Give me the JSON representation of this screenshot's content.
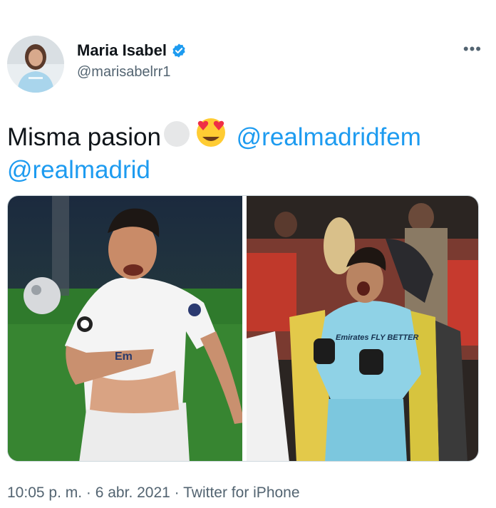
{
  "author": {
    "display_name": "Maria Isabel",
    "handle": "@marisabelrr1",
    "verified": true
  },
  "tweet": {
    "text_prefix": "Misma pasion",
    "mention_1": "@realmadridfem",
    "mention_2": "@realmadrid",
    "emojis": [
      "white-circle",
      "heart-eyes-face"
    ],
    "more_label": "•••"
  },
  "media": {
    "photos": [
      {
        "subject": "male-player-white-kit",
        "sponsor_text": "Em"
      },
      {
        "subject": "goalkeeper-light-blue-kit",
        "sponsor_text": "Emirates FLY BETTER"
      }
    ]
  },
  "meta": {
    "time": "10:05 p. m.",
    "separator": " · ",
    "date": "6 abr. 2021",
    "source": "Twitter for iPhone"
  },
  "colors": {
    "link": "#1d9bf0",
    "secondary_text": "#536471",
    "verified": "#1d9bf0"
  }
}
